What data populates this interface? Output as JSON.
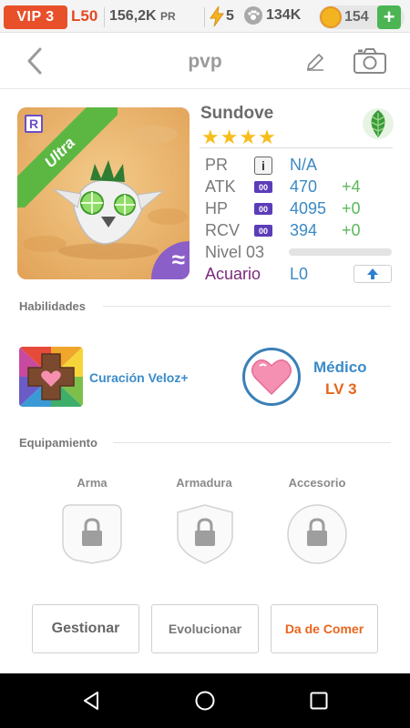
{
  "status": {
    "vip": "VIP 3",
    "level": "L50",
    "power_value": "156,2K",
    "power_unit": "PR",
    "energy": "5",
    "paws": "134K",
    "coins": "154",
    "add_label": "+"
  },
  "header": {
    "title": "pvp"
  },
  "monster": {
    "rank_badge": "R",
    "rarity": "Ultra",
    "name": "Sundove",
    "stars": "★★★★",
    "element": "leaf-icon",
    "element_badge": "≈",
    "stats": {
      "pr_label": "PR",
      "pr_value": "N/A",
      "atk_label": "ATK",
      "atk_value": "470",
      "atk_bonus": "+4",
      "hp_label": "HP",
      "hp_value": "4095",
      "hp_bonus": "+0",
      "rcv_label": "RCV",
      "rcv_value": "394",
      "rcv_bonus": "+0",
      "zz_label": "00"
    },
    "level_label": "Nivel 03",
    "level_progress": 0.0,
    "awaken_label": "Acuario",
    "awaken_value": "L0"
  },
  "skills": {
    "title": "Habilidades",
    "active_name": "Curación Veloz+",
    "leader_name": "Médico",
    "leader_level": "LV 3"
  },
  "equipment": {
    "title": "Equipamiento",
    "slots": [
      "Arma",
      "Armadura",
      "Accesorio"
    ]
  },
  "actions": {
    "manage": "Gestionar",
    "evolve": "Evolucionar",
    "feed": "Da de Comer"
  },
  "colors": {
    "accent_blue": "#3b8bc8",
    "vip_orange": "#e8502a",
    "bonus_green": "#5cb85c",
    "feed_orange": "#e8651d"
  }
}
